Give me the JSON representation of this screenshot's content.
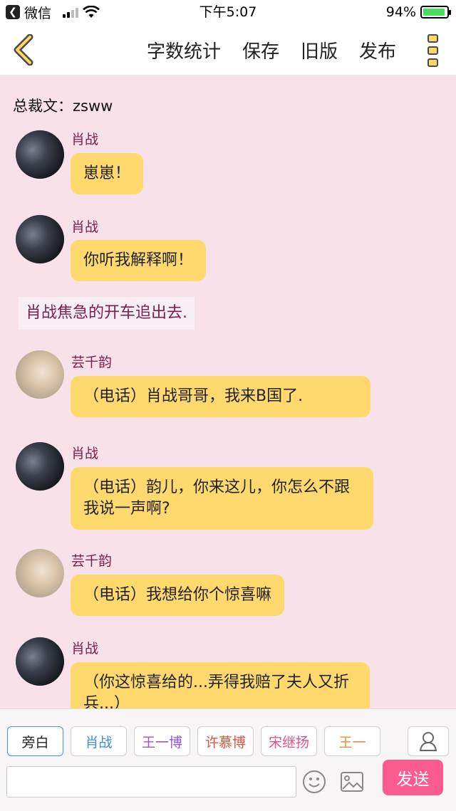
{
  "status_bar": {
    "back_app_label": "微信",
    "time": "下午5:07",
    "battery_percent": "94%",
    "battery_level": 0.94
  },
  "navbar": {
    "actions": [
      "字数统计",
      "保存",
      "旧版",
      "发布"
    ]
  },
  "chat": {
    "author_line": "总裁文：zsww",
    "messages": [
      {
        "type": "bubble",
        "speaker": "肖战",
        "text": "崽崽！"
      },
      {
        "type": "bubble",
        "speaker": "肖战",
        "text": "你听我解释啊！"
      },
      {
        "type": "narration",
        "text": "肖战焦急的开车追出去."
      },
      {
        "type": "bubble",
        "speaker": "芸千韵",
        "text": "（电话）肖战哥哥，我来B国了."
      },
      {
        "type": "bubble",
        "speaker": "肖战",
        "text": "（电话）韵儿，你来这儿，你怎么不跟我说一声啊?"
      },
      {
        "type": "bubble",
        "speaker": "芸千韵",
        "text": "（电话）我想给你个惊喜嘛"
      },
      {
        "type": "bubble",
        "speaker": "肖战",
        "text": "（你这惊喜给的...弄得我赔了夫人又折兵...）"
      }
    ]
  },
  "bottom_bar": {
    "roles": [
      {
        "label": "旁白",
        "color": "#222222"
      },
      {
        "label": "肖战",
        "color": "#3a8fd6"
      },
      {
        "label": "王一博",
        "color": "#9a55d6"
      },
      {
        "label": "许慕博",
        "color": "#e0533e"
      },
      {
        "label": "宋继扬",
        "color": "#e0538a"
      },
      {
        "label": "王一",
        "color": "#f08c3a"
      }
    ],
    "input_value": "",
    "send_label": "发送"
  },
  "colors": {
    "background": "#f9e1ea",
    "bubble": "#ffd96e",
    "speaker_name": "#7a1e4e",
    "send_button": "#fa5c8f"
  }
}
